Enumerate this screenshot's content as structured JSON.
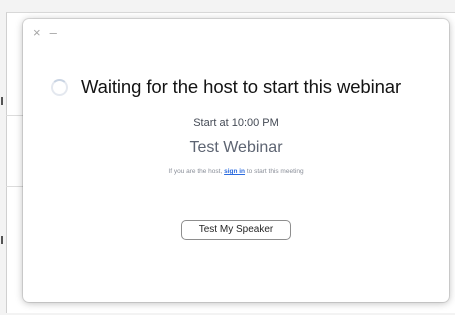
{
  "window": {
    "close_glyph": "×",
    "minimize_glyph": "–"
  },
  "waiting": {
    "title": "Waiting for the host to start this webinar"
  },
  "webinar": {
    "start_time": "Start at 10:00 PM",
    "name": "Test Webinar"
  },
  "host_note": {
    "prefix": "If you are the host, ",
    "link_label": "sign in",
    "suffix": " to start this meeting"
  },
  "actions": {
    "test_speaker_label": "Test My Speaker"
  },
  "colors": {
    "link": "#2d6cdf",
    "title_text": "#141414",
    "webinar_name": "#5d6472"
  },
  "icons": {
    "loading": "loading-spinner-icon",
    "close": "close-icon",
    "minimize": "minimize-icon"
  }
}
